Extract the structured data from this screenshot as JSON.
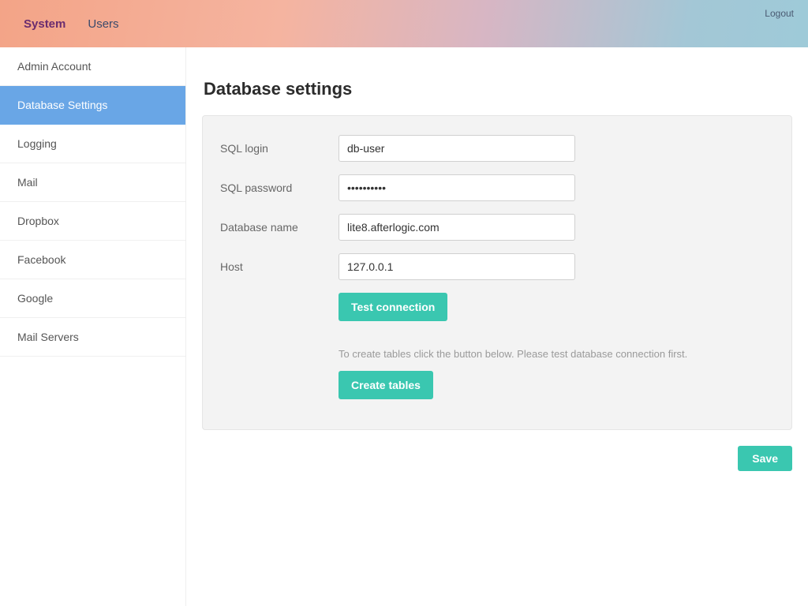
{
  "topbar": {
    "nav": [
      {
        "label": "System",
        "active": true
      },
      {
        "label": "Users",
        "active": false
      }
    ],
    "logout": "Logout"
  },
  "sidebar": {
    "items": [
      {
        "label": "Admin Account",
        "active": false
      },
      {
        "label": "Database Settings",
        "active": true
      },
      {
        "label": "Logging",
        "active": false
      },
      {
        "label": "Mail",
        "active": false
      },
      {
        "label": "Dropbox",
        "active": false
      },
      {
        "label": "Facebook",
        "active": false
      },
      {
        "label": "Google",
        "active": false
      },
      {
        "label": "Mail Servers",
        "active": false
      }
    ]
  },
  "page": {
    "title": "Database settings",
    "fields": {
      "sql_login": {
        "label": "SQL login",
        "value": "db-user"
      },
      "sql_password": {
        "label": "SQL password",
        "value": "••••••••••"
      },
      "database_name": {
        "label": "Database name",
        "value": "lite8.afterlogic.com"
      },
      "host": {
        "label": "Host",
        "value": "127.0.0.1"
      }
    },
    "test_connection_label": "Test connection",
    "helper_text": "To create tables click the button below. Please test database connection first.",
    "create_tables_label": "Create tables",
    "save_label": "Save"
  }
}
